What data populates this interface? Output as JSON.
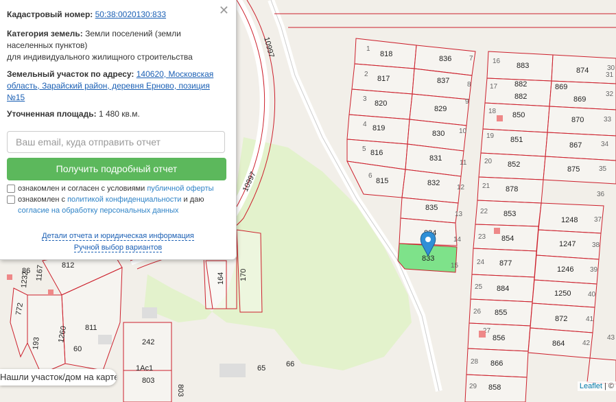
{
  "popup": {
    "cadastral_label": "Кадастровый номер:",
    "cadastral_value": "50:38:0020130:833",
    "category_label": "Категория земель:",
    "category_value_1": "Земли поселений (земли",
    "category_value_2": "населенных пунктов)",
    "category_value_3": "для индивидуального жилищного строительства",
    "address_label": "Земельный участок по адресу:",
    "address_value_1": "140620, Московская",
    "address_value_2": "область, Зарайский район, деревня Ерново, позиция",
    "address_value_3": "№15",
    "area_label": "Уточненная площадь:",
    "area_value": "1 480 кв.м.",
    "email_placeholder": "Ваш email, куда отправить отчет",
    "submit_label": "Получить подробный отчет",
    "consent1_text": "ознакомлен и согласен с условиями",
    "consent1_link": "публичной оферты",
    "consent2_text_a": "ознакомлен с",
    "consent2_link_a": "политикой конфиденциальности",
    "consent2_text_b": "и даю",
    "consent2_link_b": "согласие на обработку персональных данных",
    "details_link": "Детали отчета и юридическая информация",
    "manual_link": "Ручной выбор вариантов",
    "close_icon": "close-icon"
  },
  "bottom_bar": {
    "text": "Нашли участок/дом на карте?"
  },
  "attribution": {
    "leaflet": "Leaflet",
    "sep": "| ©"
  },
  "map": {
    "colors": {
      "parcel_border": "#cc1f2b",
      "selected_fill": "#7ee28a",
      "park": "#e3f2cc",
      "marker": "#2f8fd6"
    },
    "marker_icon": "map-pin-icon",
    "selected_parcel": "833",
    "road_labels": [
      "10997",
      "10997"
    ],
    "parcels": [
      "818",
      "836",
      "817",
      "837",
      "820",
      "829",
      "819",
      "830",
      "816",
      "831",
      "815",
      "832",
      "835",
      "834",
      "833",
      "883",
      "874",
      "882",
      "869",
      "882",
      "869",
      "850",
      "870",
      "851",
      "867",
      "852",
      "875",
      "878",
      "853",
      "1248",
      "854",
      "1247",
      "877",
      "1246",
      "884",
      "1250",
      "855",
      "872",
      "856",
      "864",
      "866",
      "858",
      "812",
      "1232",
      "1167",
      "772",
      "193",
      "1260",
      "811",
      "242",
      "803",
      "65",
      "66",
      "164",
      "170",
      "60",
      "86",
      "1Ас1"
    ],
    "numbers": [
      "1",
      "2",
      "3",
      "4",
      "5",
      "6",
      "7",
      "8",
      "9",
      "10",
      "11",
      "12",
      "13",
      "14",
      "15",
      "16",
      "17",
      "18",
      "19",
      "20",
      "21",
      "22",
      "23",
      "24",
      "25",
      "26",
      "27",
      "28",
      "29",
      "30",
      "31",
      "32",
      "33",
      "34",
      "35",
      "36",
      "37",
      "38",
      "39",
      "40",
      "41",
      "42",
      "43"
    ]
  }
}
